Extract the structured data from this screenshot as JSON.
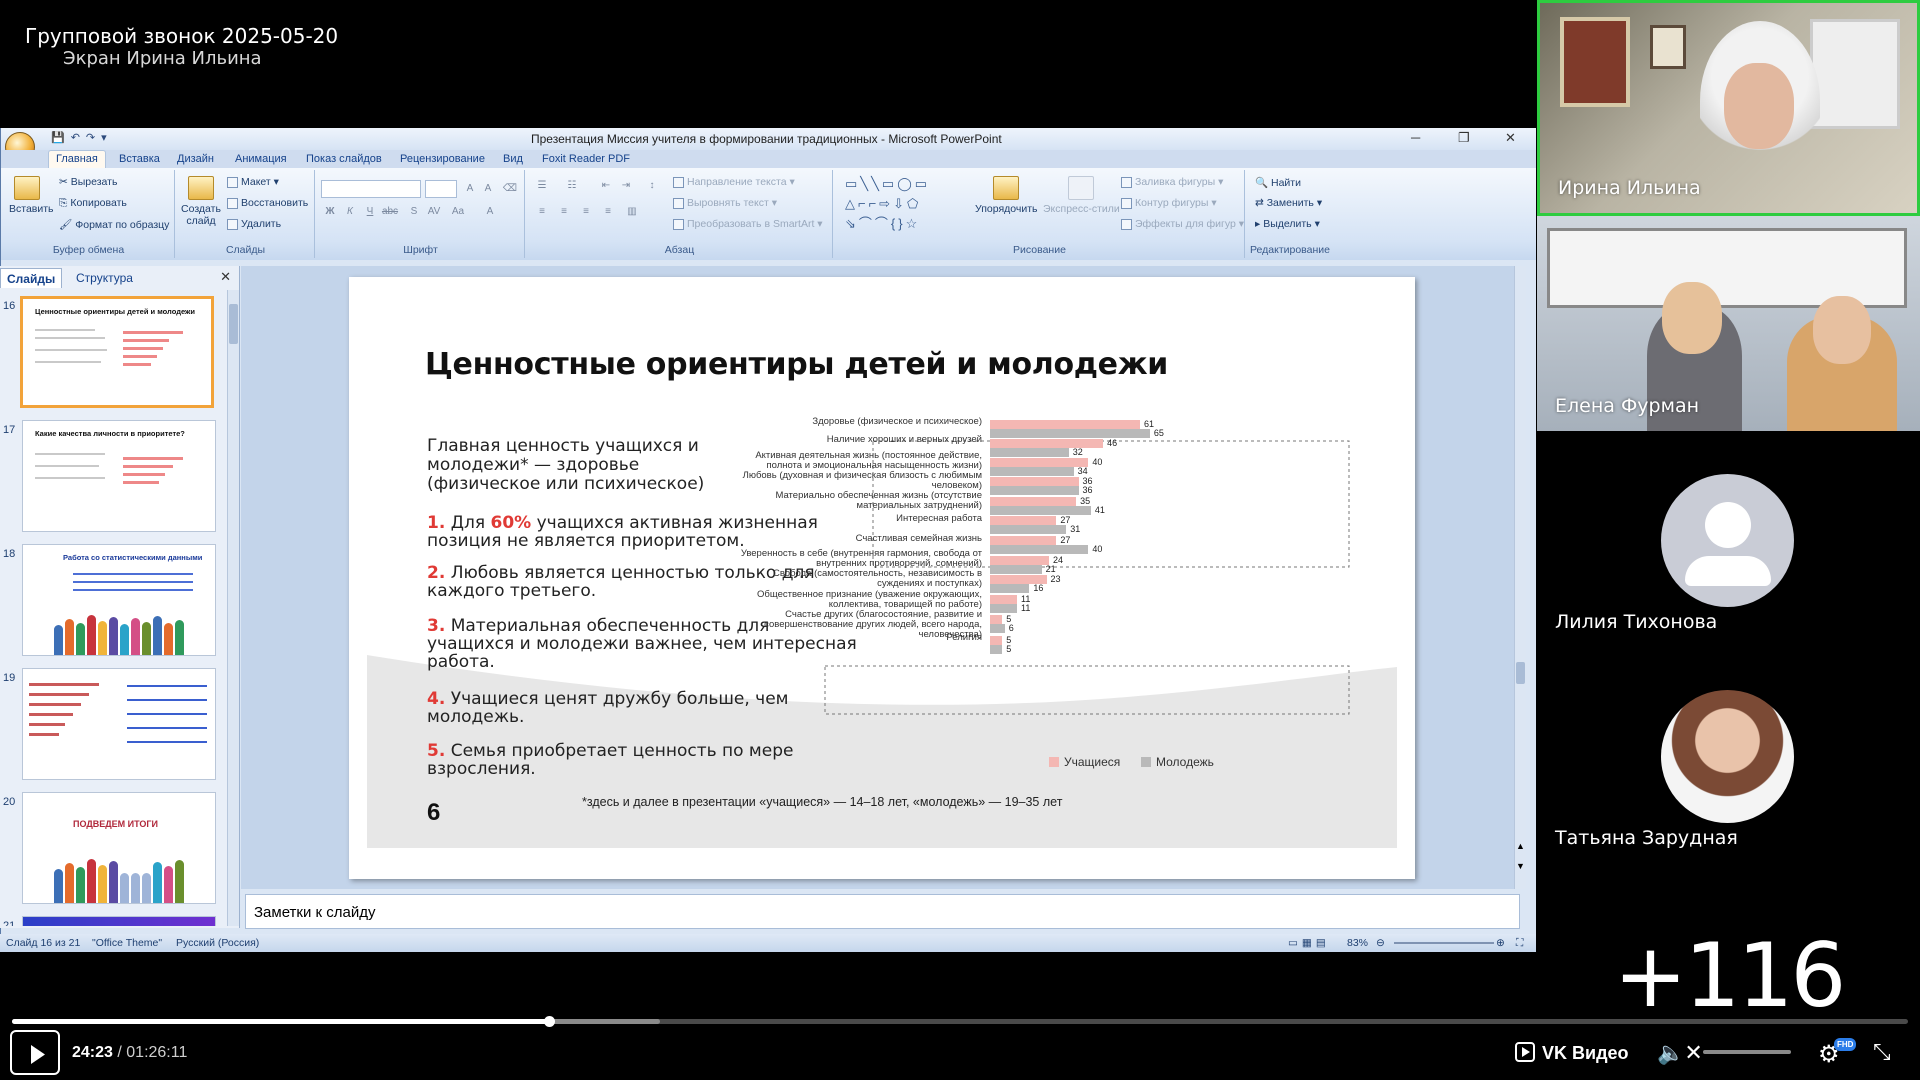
{
  "call": {
    "title": "Групповой звонок 2025-05-20",
    "screen_owner": "Экран Ирина Ильина"
  },
  "ppt": {
    "window_title": "Презентация Миссия учителя в формировании традиционных - Microsoft PowerPoint",
    "tabs": [
      "Главная",
      "Вставка",
      "Дизайн",
      "Анимация",
      "Показ слайдов",
      "Рецензирование",
      "Вид",
      "Foxit Reader PDF"
    ],
    "ribbon": {
      "clipboard": {
        "paste": "Вставить",
        "cut": "Вырезать",
        "copy": "Копировать",
        "format": "Формат по образцу",
        "label": "Буфер обмена"
      },
      "slides": {
        "create": "Создать слайд",
        "layout": "Макет",
        "restore": "Восстановить",
        "delete": "Удалить",
        "label": "Слайды"
      },
      "font": {
        "label": "Шрифт"
      },
      "paragraph": {
        "direction": "Направление текста",
        "align": "Выровнять текст",
        "smartart": "Преобразовать в SmartArt",
        "label": "Абзац"
      },
      "drawing": {
        "arrange": "Упорядочить",
        "styles": "Экспресс-стили",
        "fill": "Заливка фигуры",
        "outline": "Контур фигуры",
        "effects": "Эффекты для фигур",
        "label": "Рисование"
      },
      "editing": {
        "find": "Найти",
        "replace": "Заменить",
        "select": "Выделить",
        "label": "Редактирование"
      }
    },
    "panel_tabs": {
      "slides": "Слайды",
      "outline": "Структура"
    },
    "thumbs": [
      {
        "num": "16",
        "title": "Ценностные ориентиры детей и молодежи"
      },
      {
        "num": "17",
        "title": "Какие качества личности в приоритете?"
      },
      {
        "num": "18",
        "title": "Работа со статистическими данными"
      },
      {
        "num": "19",
        "title": ""
      },
      {
        "num": "20",
        "title": "ПОДВЕДЕМ ИТОГИ"
      },
      {
        "num": "21",
        "title": ""
      }
    ],
    "notes_placeholder": "Заметки к слайду",
    "status": {
      "slide": "Слайд 16 из 21",
      "theme": "\"Office Theme\"",
      "lang": "Русский (Россия)",
      "zoom": "83%"
    }
  },
  "slide": {
    "title": "Ценностные ориентиры детей и молодежи",
    "lead": "Главная ценность учащихся и молодежи* — здоровье (физическое или психическое)",
    "points": [
      {
        "n": "1.",
        "pre": " Для ",
        "hl": "60%",
        "text": " учащихся активная жизненная позиция не является приоритетом."
      },
      {
        "n": "2.",
        "pre": " ",
        "hl": "",
        "text": "Любовь является ценностью только для каждого третьего."
      },
      {
        "n": "3.",
        "pre": " ",
        "hl": "",
        "text": "Материальная обеспеченность для учащихся и молодежи важнее, чем интересная работа."
      },
      {
        "n": "4.",
        "pre": " ",
        "hl": "",
        "text": "Учащиеся ценят дружбу больше, чем молодежь."
      },
      {
        "n": "5.",
        "pre": " ",
        "hl": "",
        "text": "Семья приобретает ценность по мере взросления."
      }
    ],
    "page_num": "6",
    "footnote": "*здесь и далее в презентации «учащиеся» — 14–18 лет, «молодежь» — 19–35 лет"
  },
  "chart_data": {
    "type": "bar",
    "orientation": "horizontal",
    "categories": [
      "Здоровье (физическое и психическое)",
      "Наличие хороших и верных друзей",
      "Активная деятельная жизнь (постоянное действие, полнота и эмоциональная насыщенность жизни)",
      "Любовь (духовная и физическая близость с любимым человеком)",
      "Материально обеспеченная жизнь (отсутствие материальных затруднений)",
      "Интересная работа",
      "Счастливая семейная жизнь",
      "Уверенность в себе (внутренняя гармония, свобода от внутренних противоречий, сомнений)",
      "Свобода (самостоятельность, независимость в суждениях и поступках)",
      "Общественное признание (уважение окружающих, коллектива, товарищей по работе)",
      "Счастье других (благосостояние, развитие и совершенствование других людей, всего народа, человечества)",
      "Религия"
    ],
    "series": [
      {
        "name": "Учащиеся",
        "color": "#f4b7b3",
        "values": [
          61,
          46,
          40,
          36,
          35,
          27,
          27,
          24,
          23,
          11,
          5,
          5
        ]
      },
      {
        "name": "Молодежь",
        "color": "#b9b9b9",
        "values": [
          65,
          32,
          34,
          36,
          41,
          31,
          40,
          21,
          16,
          11,
          6,
          5
        ]
      }
    ],
    "xlim": [
      0,
      70
    ],
    "legend": "bottom"
  },
  "participants": [
    {
      "name": "Ирина Ильина",
      "active": true
    },
    {
      "name": "Елена Фурман"
    },
    {
      "name": "Лилия Тихонова"
    },
    {
      "name": "Татьяна Зарудная"
    }
  ],
  "more_count": "+116",
  "player": {
    "current": "24:23",
    "total": "01:26:11",
    "brand": "VK Видео",
    "quality": "FHD",
    "progress": 0.283
  }
}
